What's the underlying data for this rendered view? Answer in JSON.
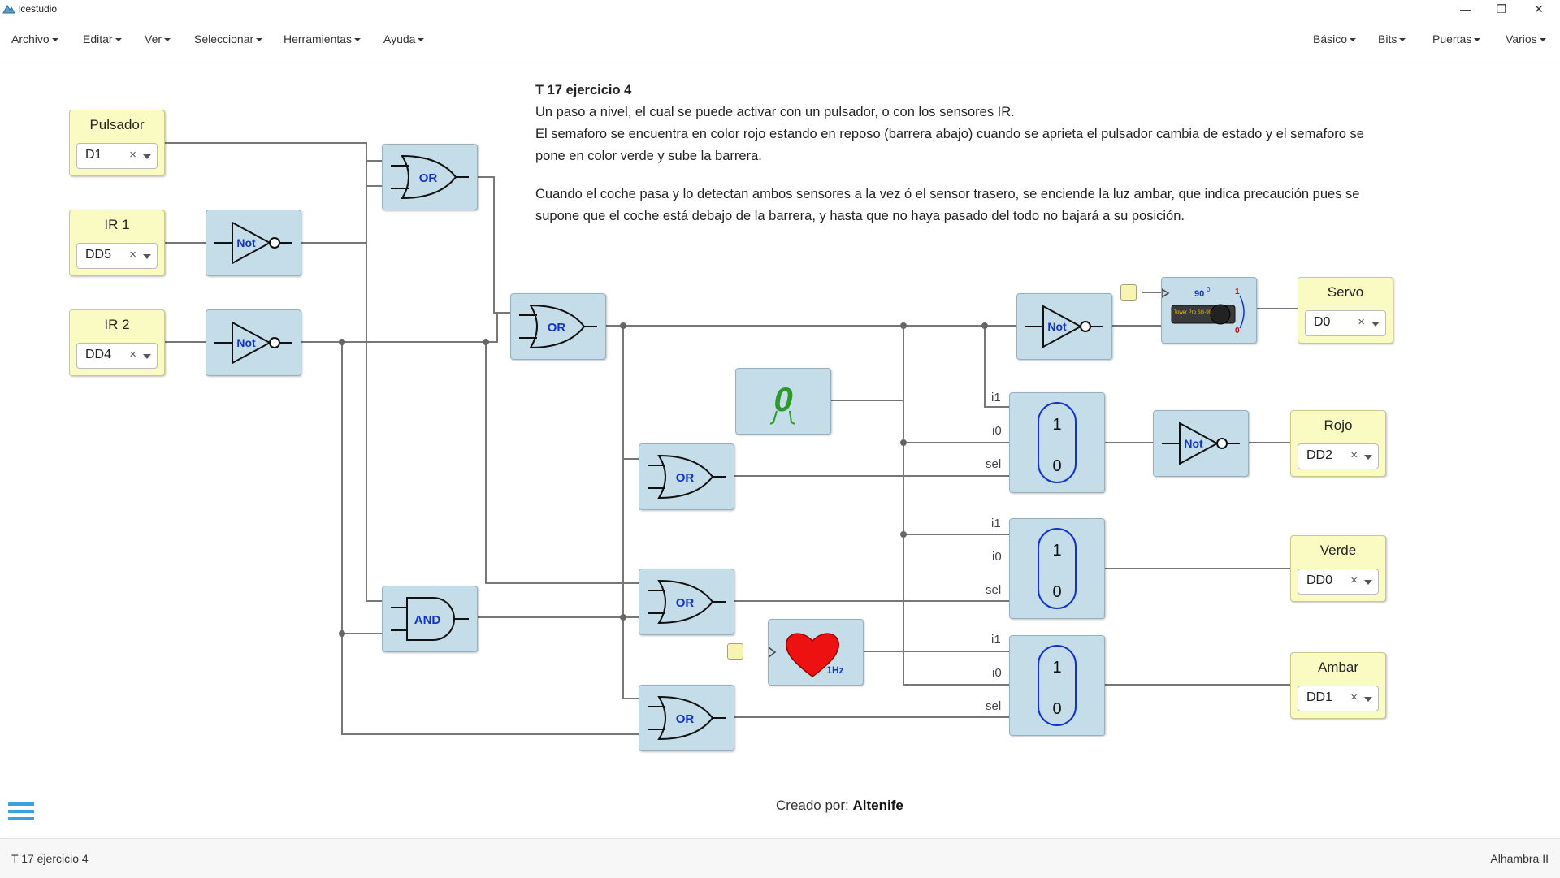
{
  "window": {
    "title": "Icestudio",
    "minimize": "—",
    "maximize": "❐",
    "close": "✕"
  },
  "menubar": {
    "left": [
      "Archivo",
      "Editar",
      "Ver",
      "Seleccionar",
      "Herramientas",
      "Ayuda"
    ],
    "right": [
      "Básico",
      "Bits",
      "Puertas",
      "Varios"
    ]
  },
  "info": {
    "title": "T 17 ejercicio 4",
    "line1": "Un paso a nivel, el cual se puede activar con un pulsador, o con los sensores IR.",
    "line2": "El semaforo se encuentra en color rojo estando en reposo (barrera abajo) cuando se aprieta el pulsador cambia de estado y el semaforo se pone en color verde y sube la barrera.",
    "line3": "Cuando el coche pasa y lo detectan ambos sensores a la vez ó el sensor trasero, se enciende la luz ambar, que indica precaución pues se supone que el coche está debajo de la barrera, y hasta que no haya pasado del todo no bajará a su posición."
  },
  "inputs": [
    {
      "label": "Pulsador",
      "pin": "D1"
    },
    {
      "label": "IR 1",
      "pin": "DD5"
    },
    {
      "label": "IR 2",
      "pin": "DD4"
    }
  ],
  "outputs": [
    {
      "label": "Servo",
      "pin": "D0"
    },
    {
      "label": "Rojo",
      "pin": "DD2"
    },
    {
      "label": "Verde",
      "pin": "DD0"
    },
    {
      "label": "Ambar",
      "pin": "DD1"
    }
  ],
  "gates": {
    "or": "OR",
    "and": "AND",
    "not": "Not"
  },
  "mux": {
    "i1": "i1",
    "i0": "i0",
    "sel": "sel",
    "one": "1",
    "zero": "0"
  },
  "constant": {
    "value": "0"
  },
  "heart": {
    "freq": "1Hz"
  },
  "servo": {
    "angle": "90",
    "deg": "0",
    "one": "1",
    "zero": "0",
    "chip_text": "Tower Pro SG-90"
  },
  "footer": {
    "creado_prefix": "Creado por:",
    "author": "Altenife"
  },
  "status": {
    "left": "T 17 ejercicio 4",
    "right": "Alhambra II"
  },
  "colors": {
    "io_bg": "#fafac3",
    "block_bg": "#c5dde9",
    "wire": "#777777",
    "gate_text": "#1133cc",
    "accent": "#3aa3dd"
  },
  "icons": [
    "app-icon",
    "hamburger-icon",
    "heart-icon",
    "servo-icon",
    "constant-zero-icon"
  ]
}
